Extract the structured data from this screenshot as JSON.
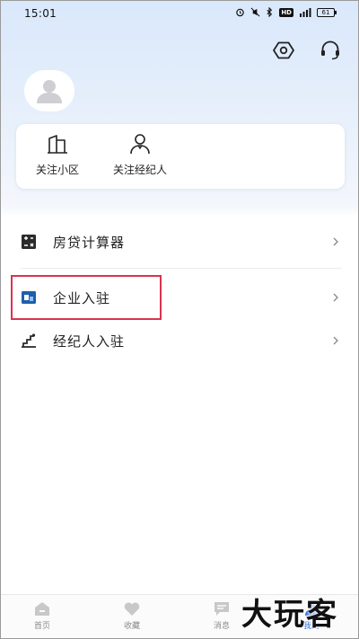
{
  "status_bar": {
    "time": "15:01",
    "battery": "61"
  },
  "header": {
    "settings_icon": "settings-hexagon-icon",
    "service_icon": "headset-icon"
  },
  "profile": {
    "avatar_icon": "user-avatar-icon"
  },
  "follow_card": {
    "items": [
      {
        "label": "关注小区",
        "icon": "building-icon"
      },
      {
        "label": "关注经纪人",
        "icon": "person-icon"
      }
    ]
  },
  "menu": {
    "items": [
      {
        "label": "房贷计算器",
        "icon": "calculator-icon"
      },
      {
        "label": "企业入驻",
        "icon": "enterprise-icon"
      },
      {
        "label": "经纪人入驻",
        "icon": "agent-stairs-icon"
      }
    ]
  },
  "bottom_nav": {
    "items": [
      {
        "label": "首页",
        "icon": "home-icon"
      },
      {
        "label": "收藏",
        "icon": "heart-icon"
      },
      {
        "label": "消息",
        "icon": "message-icon"
      },
      {
        "label": "我的",
        "icon": "mine-icon",
        "active": true
      }
    ]
  },
  "watermark": {
    "text": "大玩客"
  },
  "colors": {
    "accent": "#2f6fe0",
    "highlight": "#d9334e",
    "header_gradient_top": "#d9e8fb"
  }
}
